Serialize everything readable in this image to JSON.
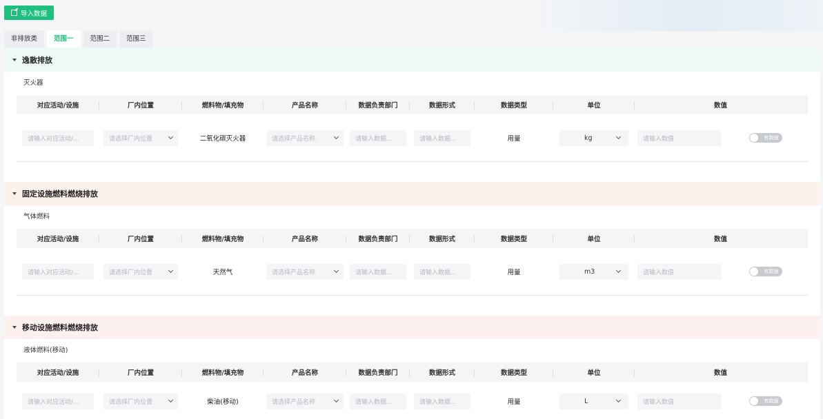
{
  "toolbar": {
    "import_label": "导入数据"
  },
  "tabs": [
    {
      "label": "非排放类"
    },
    {
      "label": "范围一"
    },
    {
      "label": "范围二"
    },
    {
      "label": "范围三"
    }
  ],
  "columns": [
    "对应活动/设施",
    "厂内位置",
    "燃料物/填充物",
    "产品名称",
    "数据负责部门",
    "数据形式",
    "数据类型",
    "单位",
    "数值"
  ],
  "placeholders": {
    "activity": "请输入对应活动/...",
    "location": "请选择厂内位置",
    "product": "请选择产品名称",
    "dept": "请输入数据...",
    "form": "请输入数据...",
    "value": "请输入数值"
  },
  "toggle_label": "有数据",
  "sections": [
    {
      "title": "逸散排放",
      "group": "灭火器",
      "row": {
        "fuel": "二氧化碳灭火器",
        "data_type": "用量",
        "unit": "kg"
      }
    },
    {
      "title": "固定设施燃料燃烧排放",
      "group": "气体燃料",
      "row": {
        "fuel": "天然气",
        "data_type": "用量",
        "unit": "m3"
      }
    },
    {
      "title": "移动设施燃料燃烧排放",
      "group": "液体燃料(移动)",
      "row": {
        "fuel": "柴油(移动)",
        "data_type": "用量",
        "unit": "L"
      }
    }
  ]
}
